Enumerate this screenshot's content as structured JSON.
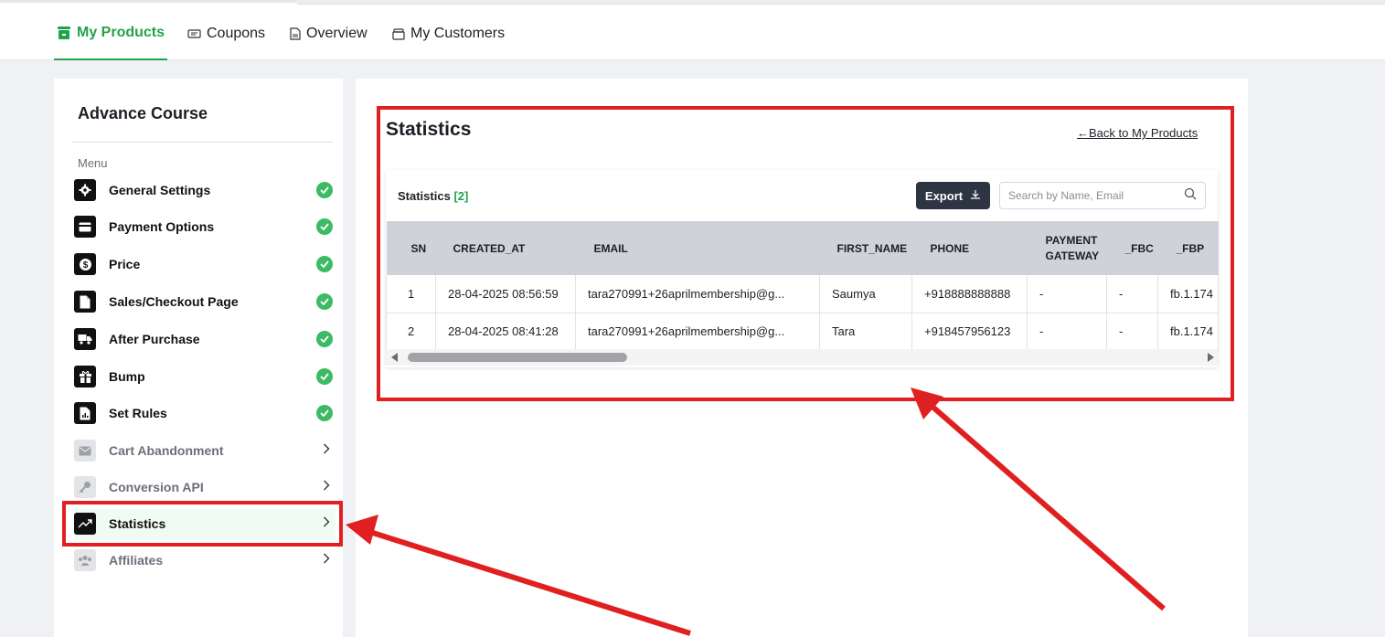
{
  "tabs": [
    {
      "label": "My Products",
      "icon": "store-icon",
      "active": true
    },
    {
      "label": "Coupons",
      "icon": "ticket-icon"
    },
    {
      "label": "Overview",
      "icon": "document-icon"
    },
    {
      "label": "My Customers",
      "icon": "box-icon"
    }
  ],
  "sidebar": {
    "course_title": "Advance Course",
    "menu_label": "Menu",
    "items": [
      {
        "label": "General Settings",
        "icon": "gear-icon",
        "status": "complete"
      },
      {
        "label": "Payment Options",
        "icon": "card-icon",
        "status": "complete"
      },
      {
        "label": "Price",
        "icon": "dollar-icon",
        "status": "complete"
      },
      {
        "label": "Sales/Checkout Page",
        "icon": "page-icon",
        "status": "complete"
      },
      {
        "label": "After Purchase",
        "icon": "truck-icon",
        "status": "complete"
      },
      {
        "label": "Bump",
        "icon": "gift-icon",
        "status": "complete"
      },
      {
        "label": "Set Rules",
        "icon": "rules-icon",
        "status": "complete"
      },
      {
        "label": "Cart Abandonment",
        "icon": "mail-icon",
        "status": "disabled"
      },
      {
        "label": "Conversion API",
        "icon": "key-icon",
        "status": "disabled"
      },
      {
        "label": "Statistics",
        "icon": "trend-icon",
        "status": "selected"
      },
      {
        "label": "Affiliates",
        "icon": "people-icon",
        "status": "disabled"
      }
    ]
  },
  "main": {
    "title": "Statistics",
    "back_link": "Back to My Products",
    "card": {
      "title": "Statistics",
      "count": "[2]",
      "export_label": "Export",
      "search_placeholder": "Search by Name, Email",
      "columns": [
        "SN",
        "CREATED_AT",
        "EMAIL",
        "FIRST_NAME",
        "PHONE",
        "PAYMENT GATEWAY",
        "_FBC",
        "_FBP"
      ],
      "rows": [
        [
          "1",
          "28-04-2025 08:56:59",
          "tara270991+26aprilmembership@g...",
          "Saumya",
          "+918888888888",
          "-",
          "-",
          "fb.1.174"
        ],
        [
          "2",
          "28-04-2025 08:41:28",
          "tara270991+26aprilmembership@g...",
          "Tara",
          "+918457956123",
          "-",
          "-",
          "fb.1.174"
        ]
      ]
    }
  },
  "colors": {
    "accent": "#22a34a",
    "highlight": "#e02020",
    "export_bg": "#2d3542",
    "header_bg": "#d0d2da"
  }
}
